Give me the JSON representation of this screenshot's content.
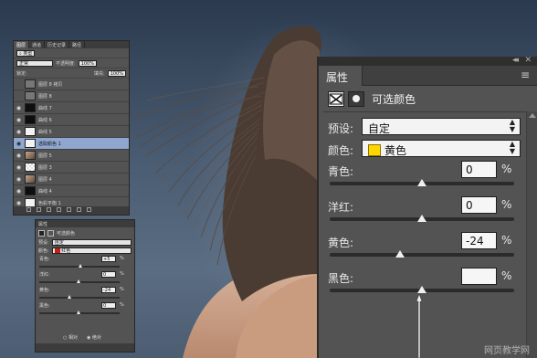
{
  "layers_panel": {
    "tabs": [
      "图层",
      "通道",
      "历史记录",
      "路径"
    ],
    "filter_label": "类型",
    "blend_mode": "正常",
    "opacity_label": "不透明度:",
    "opacity_value": "100%",
    "lock_label": "锁定:",
    "fill_label": "填充:",
    "fill_value": "100%",
    "layers": [
      {
        "name": "图层 8 拷贝",
        "thumb": "gray",
        "selected": false,
        "visible": false
      },
      {
        "name": "图层 8",
        "thumb": "gray",
        "selected": false,
        "visible": false
      },
      {
        "name": "曲线 7",
        "thumb": "black",
        "selected": false,
        "visible": true
      },
      {
        "name": "曲线 6",
        "thumb": "black",
        "selected": false,
        "visible": true
      },
      {
        "name": "曲线 5",
        "thumb": "white",
        "selected": false,
        "visible": true
      },
      {
        "name": "选取颜色 1",
        "thumb": "white",
        "selected": true,
        "visible": true
      },
      {
        "name": "图层 5",
        "thumb": "photo",
        "selected": false,
        "visible": true
      },
      {
        "name": "图层 3",
        "thumb": "check",
        "selected": false,
        "visible": true
      },
      {
        "name": "图层 4",
        "thumb": "photo",
        "selected": false,
        "visible": true
      },
      {
        "name": "曲线 4",
        "thumb": "black",
        "selected": false,
        "visible": true
      },
      {
        "name": "色彩平衡 1",
        "thumb": "white",
        "selected": false,
        "visible": true
      }
    ]
  },
  "small_properties": {
    "title": "属性",
    "header": "可选颜色",
    "preset_label": "预设:",
    "preset_value": "自定",
    "color_label": "颜色:",
    "color_value": "红色",
    "sliders": [
      {
        "label": "青色:",
        "value": "+5",
        "pct": "%",
        "knob": 0.52
      },
      {
        "label": "洋红:",
        "value": "0",
        "pct": "%",
        "knob": 0.5
      },
      {
        "label": "黄色:",
        "value": "-24",
        "pct": "%",
        "knob": 0.38
      },
      {
        "label": "黑色:",
        "value": "0",
        "pct": "%",
        "knob": 0.5
      }
    ],
    "radio_relative": "相对",
    "radio_absolute": "绝对"
  },
  "properties_panel": {
    "tab_label": "属性",
    "menu_icon": "≡",
    "header_title": "可选颜色",
    "preset_label": "预设:",
    "preset_value": "自定",
    "color_label": "颜色:",
    "color_value": "黄色",
    "swatch_color": "#ffd700",
    "sliders": [
      {
        "label": "青色:",
        "value": "0",
        "pct": "%",
        "knob": 0.5
      },
      {
        "label": "洋红:",
        "value": "0",
        "pct": "%",
        "knob": 0.5
      },
      {
        "label": "黄色:",
        "value": "-24",
        "pct": "%",
        "knob": 0.38
      },
      {
        "label": "黑色:",
        "value": "",
        "pct": "%",
        "knob": 0.5
      }
    ]
  },
  "watermark": "网页教学网"
}
